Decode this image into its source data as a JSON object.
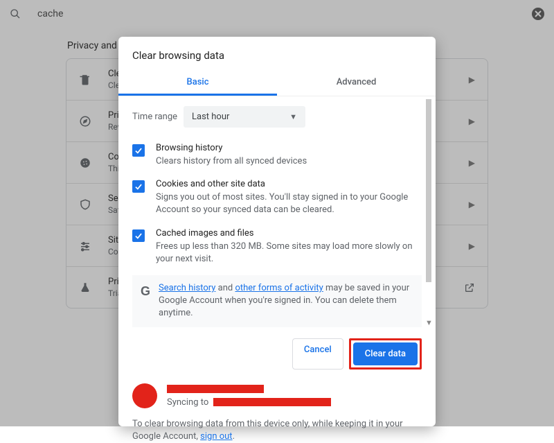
{
  "search": {
    "query": "cache"
  },
  "section_title": "Privacy and s",
  "bg_rows": [
    {
      "icon": "trash-icon",
      "title": "Clea",
      "sub": "Clea"
    },
    {
      "icon": "compass-icon",
      "title": "Priva",
      "sub": "Revi"
    },
    {
      "icon": "cookie-icon",
      "title": "Cook",
      "sub": "Third"
    },
    {
      "icon": "shield-icon",
      "title": "Secu",
      "sub": "Safe"
    },
    {
      "icon": "sliders-icon",
      "title": "Site s",
      "sub": "Cont"
    },
    {
      "icon": "flask-icon",
      "title": "Priva",
      "sub": "Trial",
      "launch": true
    }
  ],
  "dialog": {
    "title": "Clear browsing data",
    "tabs": {
      "basic": "Basic",
      "advanced": "Advanced"
    },
    "time_label": "Time range",
    "time_value": "Last hour",
    "items": [
      {
        "title": "Browsing history",
        "sub": "Clears history from all synced devices"
      },
      {
        "title": "Cookies and other site data",
        "sub": "Signs you out of most sites. You'll stay signed in to your Google Account so your synced data can be cleared."
      },
      {
        "title": "Cached images and files",
        "sub": "Frees up less than 320 MB. Some sites may load more slowly on your next visit."
      }
    ],
    "info": {
      "link1": "Search history",
      "mid1": " and ",
      "link2": "other forms of activity",
      "tail": " may be saved in your Google Account when you're signed in. You can delete them anytime."
    },
    "cancel": "Cancel",
    "clear": "Clear data",
    "account": {
      "sync_prefix": "Syncing to "
    },
    "footnote": {
      "text": "To clear browsing data from this device only, while keeping it in your Google Account, ",
      "link": "sign out",
      "tail": "."
    }
  }
}
